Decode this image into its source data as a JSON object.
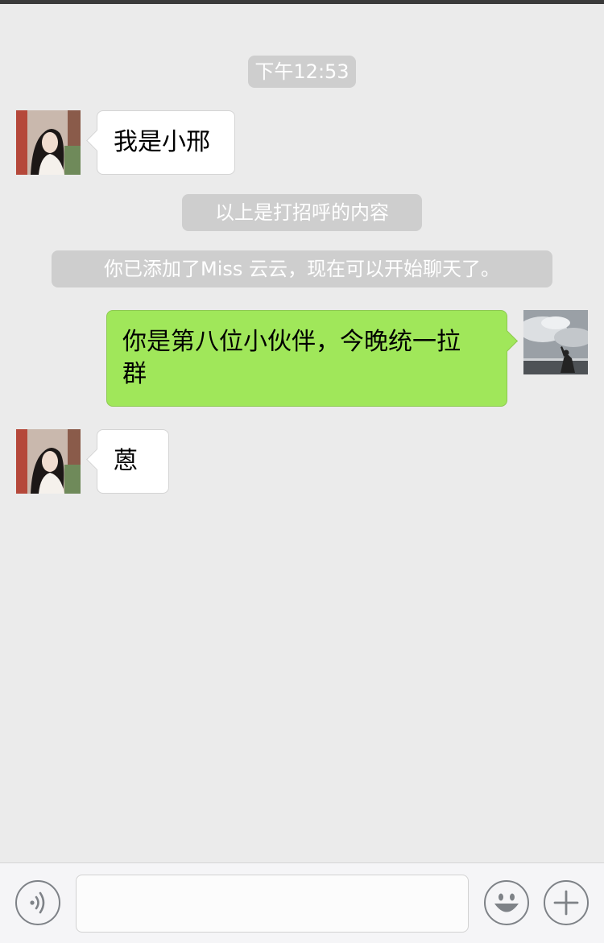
{
  "chat": {
    "timestamp": "下午12:53",
    "messages": [
      {
        "side": "in",
        "text": "我是小邢"
      },
      {
        "side": "in",
        "text": "蒽"
      }
    ],
    "system_notices": [
      "以上是打招呼的内容",
      "你已添加了Miss 云云，现在可以开始聊天了。"
    ],
    "outgoing": {
      "line1": "你是第八位小伙伴，今晚统一拉",
      "line2": "群"
    }
  },
  "input_bar": {
    "text_value": "",
    "icons": [
      "voice-icon",
      "emoji-icon",
      "plus-icon"
    ]
  },
  "colors": {
    "background": "#ebebeb",
    "outgoing_bubble": "#a0e75a",
    "incoming_bubble": "#ffffff",
    "system_pill": "#cecece"
  }
}
